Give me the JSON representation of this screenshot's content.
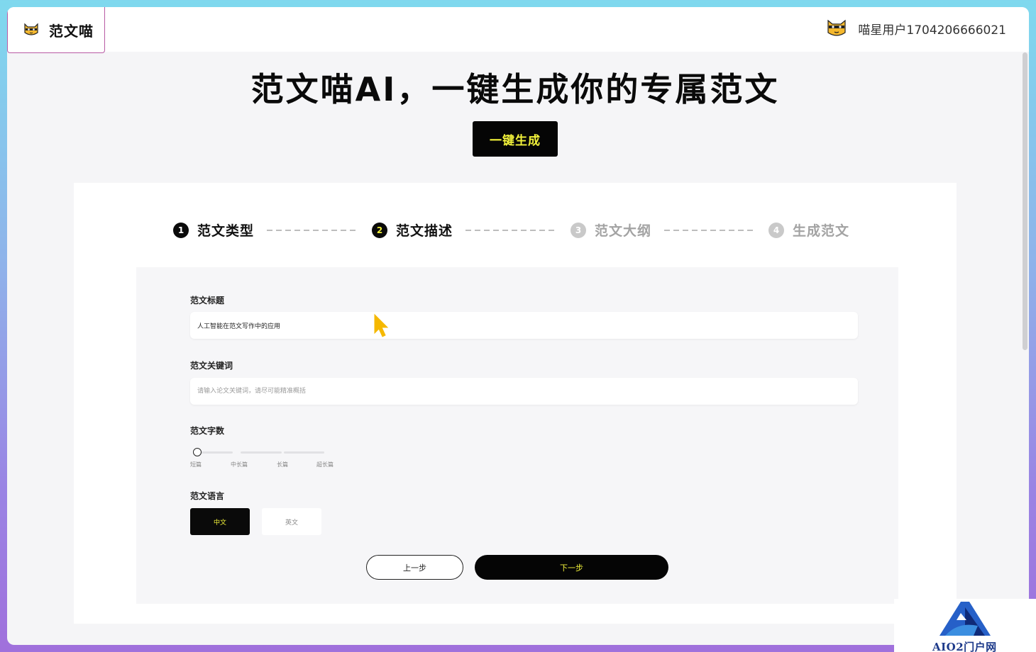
{
  "header": {
    "brand_name": "范文喵",
    "brand_icon": "cat-logo-icon",
    "user_icon": "cat-avatar-icon",
    "user_name": "喵星用户1704206666021"
  },
  "hero": {
    "title": "范文喵AI，一键生成你的专属范文",
    "cta_label": "一键生成"
  },
  "steps": [
    {
      "num": "1",
      "label": "范文类型",
      "state": "done"
    },
    {
      "num": "2",
      "label": "范文描述",
      "state": "active"
    },
    {
      "num": "3",
      "label": "范文大纲",
      "state": "todo"
    },
    {
      "num": "4",
      "label": "生成范文",
      "state": "todo"
    }
  ],
  "form": {
    "title_label": "范文标题",
    "title_value": "人工智能在范文写作中的应用",
    "keywords_label": "范文关键词",
    "keywords_placeholder": "请输入论文关键词，请尽可能精准概括",
    "length_label": "范文字数",
    "length_options": [
      "短篇",
      "中长篇",
      "长篇",
      "超长篇"
    ],
    "length_selected": "短篇",
    "language_label": "范文语言",
    "language_options": [
      "中文",
      "英文"
    ],
    "language_selected": "中文",
    "prev_label": "上一步",
    "next_label": "下一步"
  },
  "colors": {
    "accent_yellow": "#f2f23a",
    "primary_black": "#0a0a0a",
    "brand_border": "#b85aa4",
    "watermark_blue": "#1d3a8a"
  },
  "watermark": {
    "text": "AIO2门户网",
    "icon": "aio2-logo-icon"
  }
}
